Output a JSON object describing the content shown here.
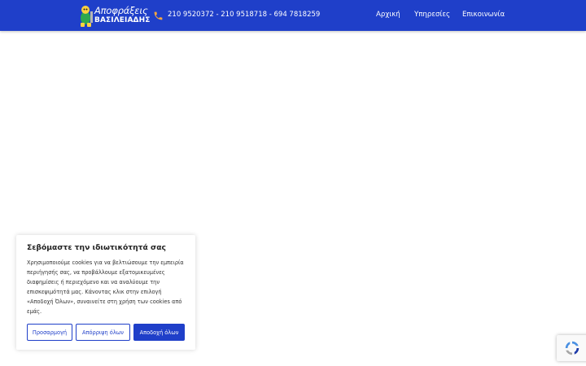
{
  "header": {
    "logo": {
      "line1": "Αποφράξεις",
      "line2": "ΒΑΣΙΛΕΙΑΔΗΣ"
    },
    "phone_icon": "phone-icon",
    "phones": "210 9520372 - 210 9518718 - 694 7818259",
    "nav": {
      "home": "Αρχική",
      "services": "Υπηρεσίες",
      "contact": "Επικοινωνία"
    }
  },
  "cookie_banner": {
    "title": "Σεβόμαστε την ιδιωτικότητά σας",
    "body": "Χρησιμοποιούμε cookies για να βελτιώσουμε την εμπειρία περιήγησής σας, να προβάλλουμε εξατομικευμένες διαφημίσεις ή περιεχόμενο και να αναλύουμε την επισκεψιμότητά μας. Κάνοντας κλικ στην επιλογή «Αποδοχή Όλων», συναινείτε στη χρήση των cookies από εμάς.",
    "buttons": {
      "customize": "Προσαρμογή",
      "reject": "Απόρριψη όλων",
      "accept": "Αποδοχή όλων"
    }
  },
  "recaptcha": {
    "icon": "recaptcha-icon"
  },
  "colors": {
    "brand_blue": "#1f3fc9",
    "phone_icon_orange": "#f4a640",
    "white": "#ffffff"
  }
}
